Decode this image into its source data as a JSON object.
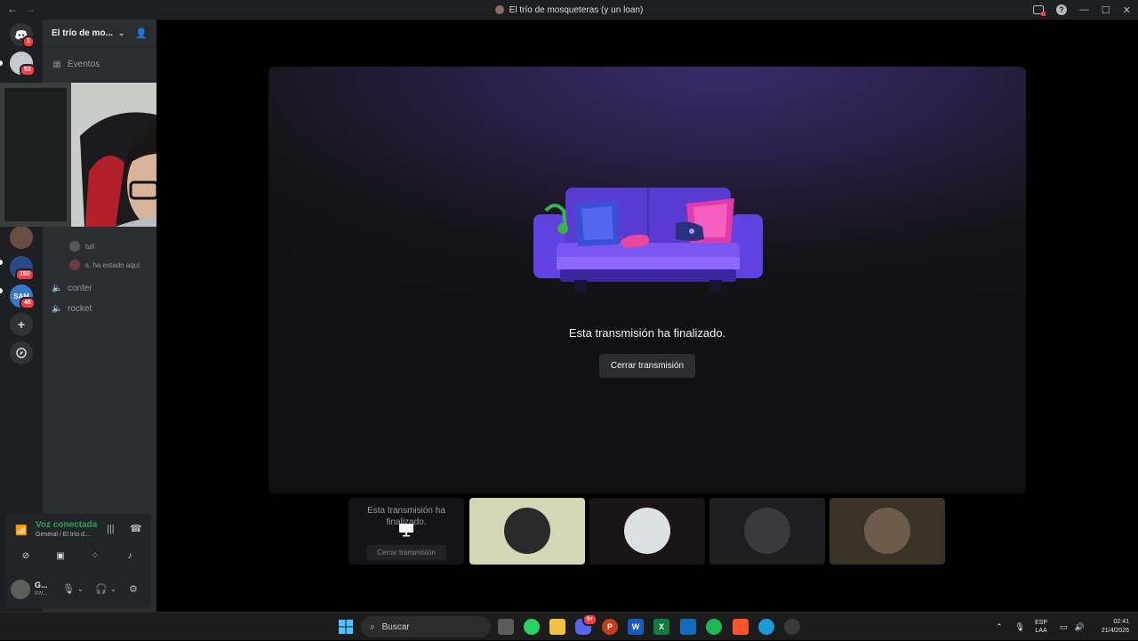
{
  "titlebar": {
    "back": "←",
    "forward": "→",
    "title": "El trío de mosqueteras (y un loan)"
  },
  "rail": {
    "home_badge": "1",
    "servers": [
      {
        "badge": "53"
      },
      {
        "badge": "150"
      },
      {
        "label": "SAM",
        "badge": "45"
      }
    ]
  },
  "sidebar": {
    "server_name": "El trío de mo...",
    "events": "Eventos",
    "members": [
      "tuli",
      "s. ha estado aquí"
    ],
    "voice_channels": [
      "conter",
      "rocket"
    ]
  },
  "voice_panel": {
    "status": "Voz conectada",
    "channel": "General / El trío d...",
    "user_name": "G...",
    "user_status": "Inv..."
  },
  "stream": {
    "ended_message": "Esta transmisión ha finalizado.",
    "close_button": "Cerrar transmisión"
  },
  "tiles": {
    "ended_text": "Esta transmisión ha finalizado.",
    "close_button": "Cerrar transmisión"
  },
  "taskbar": {
    "search_placeholder": "Buscar",
    "discord_badge": "9+",
    "lang_top": "ESP",
    "lang_bottom": "LAA",
    "time": "02:41",
    "date": "21/4/2026"
  },
  "colors": {
    "voice_connected": "#23a55a",
    "badge_red": "#f23f43",
    "sidebar_bg": "#2b2d31",
    "rail_bg": "#1e1f22"
  }
}
